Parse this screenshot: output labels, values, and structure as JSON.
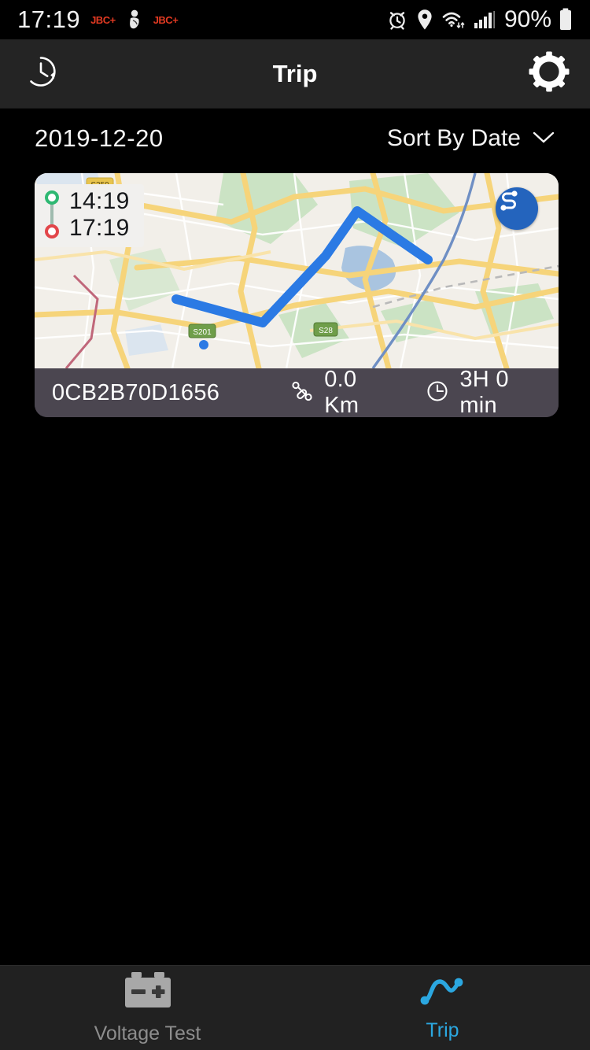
{
  "status_bar": {
    "time": "17:19",
    "notification_badges": [
      "JBC+",
      "JBC+"
    ],
    "person_icon": "person-notification-icon",
    "alarm_icon": "alarm-clock-icon",
    "location_icon": "location-pin-icon",
    "wifi_icon": "wifi-data-icon",
    "signal_icon": "cellular-signal-icon",
    "battery_percent": "90%",
    "battery_icon": "battery-icon"
  },
  "app_bar": {
    "title": "Trip",
    "left_icon": "history-clock-icon",
    "right_icon": "gear-settings-icon"
  },
  "filter_row": {
    "date": "2019-12-20",
    "sort_label": "Sort By Date",
    "sort_chevron": "chevron-down-icon"
  },
  "trip_card": {
    "start_time": "14:19",
    "end_time": "17:19",
    "start_dot_color": "#2eb872",
    "end_dot_color": "#e2464a",
    "route_fab_icon": "route-share-icon",
    "route_fab_color": "#2464bd",
    "car_pin_icon": "car-pin-icon",
    "car_pin_color": "#ea3b3b",
    "nav_arrow_icon": "navigation-arrow-icon",
    "nav_arrow_color": "#3b8ef0",
    "route_line_color": "#2b7ae4",
    "trip_id": "0CB2B70D1656",
    "distance_icon": "route-distance-icon",
    "distance": "0.0 Km",
    "duration_icon": "clock-icon",
    "duration": "3H 0 min",
    "footer_bg": "#4b4650"
  },
  "bottom_nav": {
    "items": [
      {
        "label": "Voltage Test",
        "icon": "car-battery-icon",
        "active": false
      },
      {
        "label": "Trip",
        "icon": "trip-curve-icon",
        "active": true
      }
    ],
    "active_color": "#2ba7e0",
    "inactive_color": "#8d8d8d"
  }
}
